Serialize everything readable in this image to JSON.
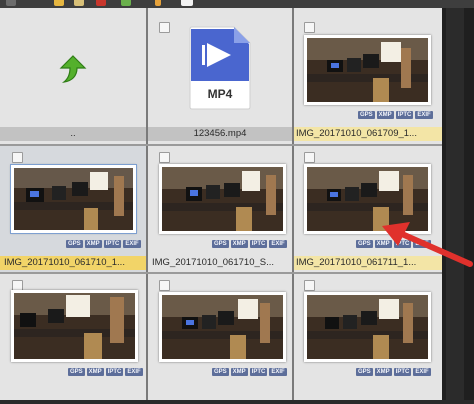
{
  "toolbar": {
    "icons": [
      "folder-icon",
      "gear-icon",
      "delete-icon",
      "move-icon",
      "upload-icon",
      "more-icon"
    ]
  },
  "badge_labels": [
    "GPS",
    "XMP",
    "IPTC",
    "EXIF"
  ],
  "cells": [
    {
      "name": "parent-folder",
      "label": "..",
      "kind": "up"
    },
    {
      "name": "mp4-file",
      "label": "123456.mp4",
      "kind": "mp4",
      "icon_text": "MP4"
    },
    {
      "name": "image-0617-09",
      "label": "IMG_20171010_061709_1..."
    },
    {
      "name": "image-0617-10-a",
      "label": "IMG_20171010_061710_1..."
    },
    {
      "name": "image-0617-10-b",
      "label": "IMG_20171010_061710_S..."
    },
    {
      "name": "image-0617-11",
      "label": "IMG_20171010_061711_1..."
    },
    {
      "name": "image-row3-a",
      "label": ""
    },
    {
      "name": "image-row3-b",
      "label": ""
    },
    {
      "name": "image-row3-c",
      "label": ""
    }
  ],
  "colors": {
    "badge": "#5d6e9a",
    "highlight": "#f3e5a6",
    "highlight_strong": "#f2d468",
    "arrow": "#e0312c"
  }
}
